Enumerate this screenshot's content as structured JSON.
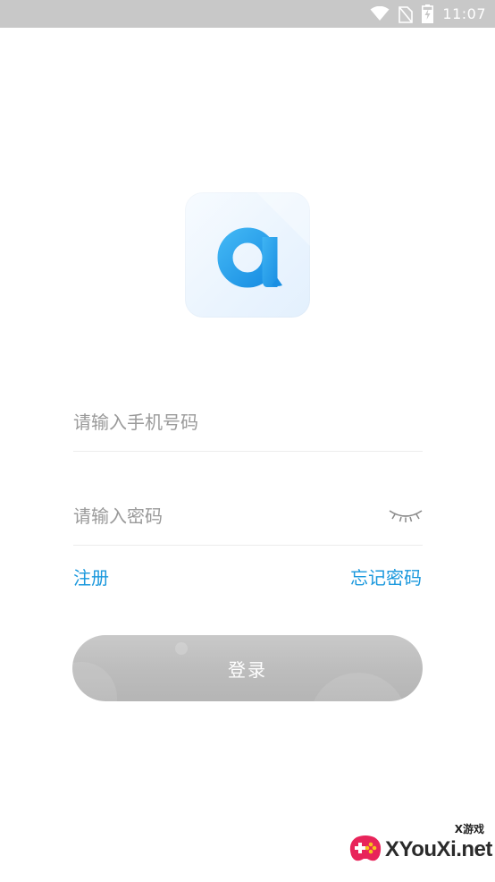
{
  "status_bar": {
    "time": "11:07",
    "icons": [
      "wifi-icon",
      "no-sim-icon",
      "battery-charging-icon"
    ]
  },
  "logo": {
    "icon": "app-logo-a",
    "accent": "#1a98dd"
  },
  "form": {
    "phone_placeholder": "请输入手机号码",
    "password_placeholder": "请输入密码",
    "eye_icon": "eye-closed-icon"
  },
  "links": {
    "register": "注册",
    "forgot_password": "忘记密码"
  },
  "login_button": {
    "label": "登录",
    "color": "#bdbdbd"
  },
  "watermark": {
    "brand": "XYouXi.net",
    "tag": "X游戏"
  }
}
